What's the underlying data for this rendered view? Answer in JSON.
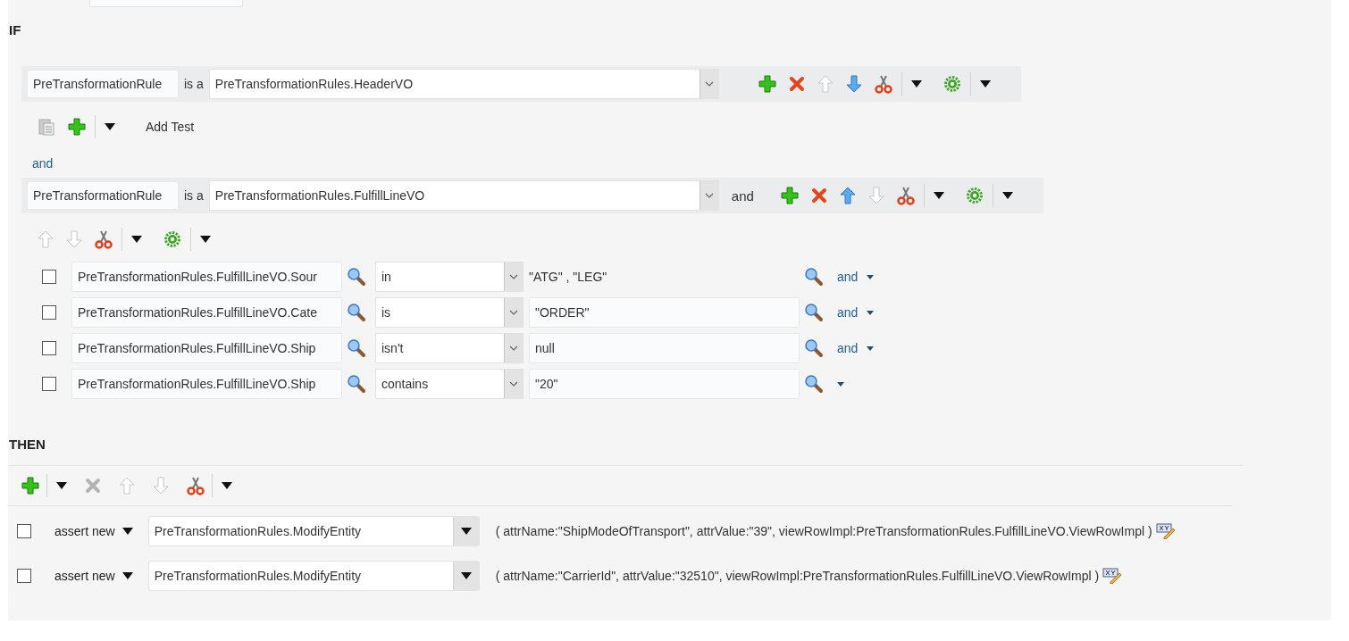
{
  "if_section": {
    "label": "IF",
    "blocks": [
      {
        "kind": "fact",
        "variable": "PreTransformationRule",
        "connector": "is a",
        "fact_type": "PreTransformationRules.HeaderVO",
        "tools": [
          {
            "kind": "add",
            "disabled": false
          },
          {
            "kind": "delete",
            "disabled": false
          },
          {
            "kind": "up",
            "disabled": true
          },
          {
            "kind": "down",
            "disabled": false
          },
          {
            "kind": "cut",
            "disabled": false
          },
          {
            "kind": "separator"
          },
          {
            "kind": "menu",
            "disabled": false
          },
          {
            "kind": "gear",
            "disabled": false
          },
          {
            "kind": "separator"
          },
          {
            "kind": "menu",
            "disabled": false
          }
        ]
      },
      {
        "kind": "toolbar",
        "tools": [
          {
            "kind": "paste",
            "disabled": true
          },
          {
            "kind": "add",
            "disabled": false
          },
          {
            "kind": "separator"
          },
          {
            "kind": "menu",
            "disabled": false
          }
        ],
        "link": "Add Test"
      },
      {
        "kind": "conjunction",
        "text": "and"
      },
      {
        "kind": "fact",
        "variable": "PreTransformationRule",
        "connector": "is a",
        "fact_type": "PreTransformationRules.FulfillLineVO",
        "conjunction": "and",
        "tools": [
          {
            "kind": "add",
            "disabled": false
          },
          {
            "kind": "delete",
            "disabled": false
          },
          {
            "kind": "up",
            "disabled": false
          },
          {
            "kind": "down",
            "disabled": true
          },
          {
            "kind": "cut",
            "disabled": false
          },
          {
            "kind": "separator"
          },
          {
            "kind": "menu",
            "disabled": false
          },
          {
            "kind": "gear",
            "disabled": false
          },
          {
            "kind": "separator"
          },
          {
            "kind": "menu",
            "disabled": false
          }
        ]
      },
      {
        "kind": "toolbar",
        "tools": [
          {
            "kind": "up",
            "disabled": true
          },
          {
            "kind": "down",
            "disabled": true
          },
          {
            "kind": "cut",
            "disabled": false
          },
          {
            "kind": "separator"
          },
          {
            "kind": "menu",
            "disabled": false
          },
          {
            "kind": "gear",
            "disabled": false
          },
          {
            "kind": "separator"
          },
          {
            "kind": "menu",
            "disabled": false
          }
        ]
      },
      {
        "kind": "tests",
        "rows": [
          {
            "checked": false,
            "left": "PreTransformationRules.FulfillLineVO.Sour",
            "operator": "in",
            "value": "\"ATG\" , \"LEG\"",
            "kind": "text",
            "connector": "and"
          },
          {
            "checked": false,
            "left": "PreTransformationRules.FulfillLineVO.Cate",
            "operator": "is",
            "value": "\"ORDER\"",
            "kind": "field",
            "connector": "and"
          },
          {
            "checked": false,
            "left": "PreTransformationRules.FulfillLineVO.Ship",
            "operator": "isn't",
            "value": "null",
            "kind": "field",
            "connector": "and"
          },
          {
            "checked": false,
            "left": "PreTransformationRules.FulfillLineVO.Ship",
            "operator": "contains",
            "value": "\"20\"",
            "kind": "field"
          }
        ]
      }
    ]
  },
  "then_section": {
    "label": "THEN",
    "toolbar": {
      "tools": [
        {
          "kind": "add",
          "disabled": false
        },
        {
          "kind": "separator"
        },
        {
          "kind": "menu",
          "disabled": false
        },
        {
          "kind": "delete",
          "disabled": true
        },
        {
          "kind": "up",
          "disabled": true
        },
        {
          "kind": "down",
          "disabled": true
        },
        {
          "kind": "cut",
          "disabled": false
        },
        {
          "kind": "separator"
        },
        {
          "kind": "menu",
          "disabled": false
        }
      ]
    },
    "actions": [
      {
        "checked": false,
        "verb": "assert new",
        "fact_type": "PreTransformationRules.ModifyEntity",
        "arguments": "( attrName:\"ShipModeOfTransport\", attrValue:\"39\", viewRowImpl:PreTransformationRules.FulfillLineVO.ViewRowImpl )"
      },
      {
        "checked": false,
        "verb": "assert new",
        "fact_type": "PreTransformationRules.ModifyEntity",
        "arguments": "( attrName:\"CarrierId\", attrValue:\"32510\", viewRowImpl:PreTransformationRules.FulfillLineVO.ViewRowImpl )"
      }
    ]
  }
}
